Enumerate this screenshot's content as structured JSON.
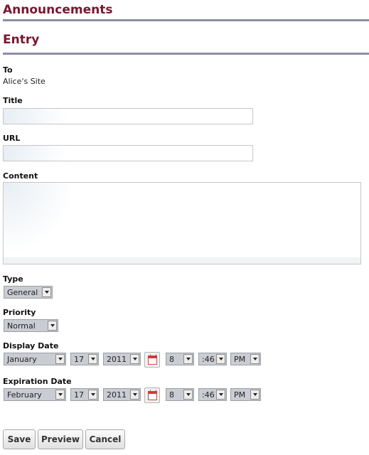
{
  "page": {
    "title": "Announcements",
    "section_title": "Entry"
  },
  "form": {
    "to_label": "To",
    "to_value": "Alice's Site",
    "title_label": "Title",
    "title_value": "",
    "url_label": "URL",
    "url_value": "",
    "content_label": "Content",
    "content_value": "",
    "type_label": "Type",
    "type_value": "General",
    "priority_label": "Priority",
    "priority_value": "Normal",
    "display_date": {
      "label": "Display Date",
      "month": "January",
      "day": "17",
      "year": "2011",
      "hour": "8",
      "minute": ":46",
      "ampm": "PM"
    },
    "expiration_date": {
      "label": "Expiration Date",
      "month": "February",
      "day": "17",
      "year": "2011",
      "hour": "8",
      "minute": ":46",
      "ampm": "PM"
    }
  },
  "buttons": {
    "save": "Save",
    "preview": "Preview",
    "cancel": "Cancel"
  },
  "icons": {
    "dropdown": "chevron-down-icon",
    "calendar": "calendar-icon"
  },
  "colors": {
    "heading": "#7b1530",
    "rule": "#8b8ea8",
    "select_bg": "#c9ccd2"
  }
}
